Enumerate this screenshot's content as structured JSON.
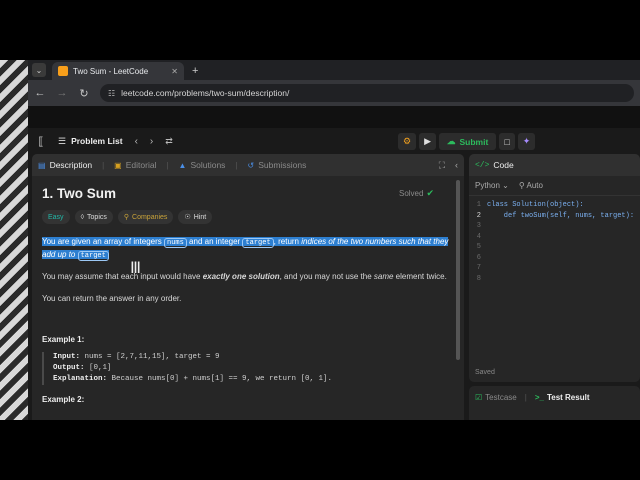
{
  "browser": {
    "tab_title": "Two Sum - LeetCode",
    "url": "leetcode.com/problems/two-sum/description/",
    "new_tab_icon": "+"
  },
  "header": {
    "problem_list_label": "Problem List",
    "submit_label": "Submit"
  },
  "left_panel": {
    "tabs": [
      {
        "label": "Description",
        "icon": "document-icon"
      },
      {
        "label": "Editorial",
        "icon": "book-icon"
      },
      {
        "label": "Solutions",
        "icon": "flask-icon"
      },
      {
        "label": "Submissions",
        "icon": "history-icon"
      }
    ],
    "title": "1. Two Sum",
    "status": "Solved",
    "chips": [
      "Easy",
      "Topics",
      "Companies",
      "Hint"
    ],
    "description": {
      "p1_a": "You are given an array of ",
      "p1_b": "integers ",
      "p1_code1": "nums",
      "p1_c": " and an integer ",
      "p1_code2": "target",
      "p1_d": ", return ",
      "p1_e": "indices of the two numbers such that they add up to",
      "p1_code3": "target",
      "p2_a": "You may assume that each input would have ",
      "p2_b": "exactly one solution",
      "p2_c": ", and you may not use the ",
      "p2_d": "same",
      "p2_e": " element twice.",
      "p3": "You can return the answer in any order."
    },
    "example1": {
      "title": "Example 1:",
      "input_label": "Input:",
      "input_value": " nums = [2,7,11,15], target = 9",
      "output_label": "Output:",
      "output_value": " [0,1]",
      "explanation_label": "Explanation:",
      "explanation_value": " Because nums[0] + nums[1] == 9, we return [0, 1]."
    },
    "example2_title": "Example 2:"
  },
  "code_panel": {
    "title": "Code",
    "language": "Python",
    "autocomplete": "Auto",
    "lines": [
      {
        "n": "1",
        "text": "class Solution(object):"
      },
      {
        "n": "2",
        "text": "    def twoSum(self, nums, target):"
      },
      {
        "n": "3",
        "text": ""
      },
      {
        "n": "4",
        "text": ""
      },
      {
        "n": "5",
        "text": ""
      },
      {
        "n": "6",
        "text": ""
      },
      {
        "n": "7",
        "text": ""
      },
      {
        "n": "8",
        "text": ""
      }
    ],
    "saved": "Saved"
  },
  "test_panel": {
    "testcase": "Testcase",
    "test_result": "Test Result"
  }
}
